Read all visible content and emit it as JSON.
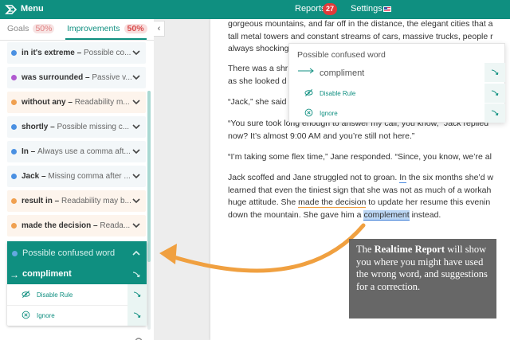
{
  "topbar": {
    "menu_label": "Menu",
    "reports_label": "Reports",
    "reports_count": "27",
    "settings_label": "Settings"
  },
  "sidebar": {
    "tabs": [
      {
        "label": "Goals",
        "pct": "50%"
      },
      {
        "label": "Improvements",
        "pct": "50%"
      }
    ],
    "items": [
      {
        "word": "in it's extreme",
        "desc": "Possible co...",
        "color": "#4a90e2"
      },
      {
        "word": "was surrounded",
        "desc": "Passive v...",
        "color": "#b05ad0"
      },
      {
        "word": "without any",
        "desc": "Readability m...",
        "color": "#f0a050"
      },
      {
        "word": "shortly",
        "desc": "Possible missing c...",
        "color": "#4a90e2"
      },
      {
        "word": "In",
        "desc": "Always use a comma aft...",
        "color": "#4a90e2"
      },
      {
        "word": "Jack",
        "desc": "Missing comma after ...",
        "color": "#4a90e2"
      },
      {
        "word": "result in",
        "desc": "Readability may b...",
        "color": "#f0a050"
      },
      {
        "word": "made the decision",
        "desc": "Reada...",
        "color": "#f0a050"
      }
    ],
    "card": {
      "title": "Possible confused word",
      "arrow": "→",
      "suggestion": "compliment",
      "disable_label": "Disable Rule",
      "ignore_label": "Ignore"
    }
  },
  "document": {
    "p1": [
      "gorgeous mountains, and far off in the distance, the elegant cities that a",
      "tall metal towers and constant streams of cars, massive trucks, people r",
      "always shocking"
    ],
    "p2": [
      "There was a shr",
      "as she looked d"
    ],
    "p3": [
      "“Jack,” she said"
    ],
    "p4": [
      "“You sure took long enough to answer my call, you know,” Jack replied",
      "now? It’s almost 9:00 AM and you’re still not here.”"
    ],
    "p5": [
      "“I’m taking some flex time,” Jane responded. “Since, you know, we’re al"
    ],
    "p6a": "Jack scoffed and Jane struggled not to groan. ",
    "p6a_in": "In",
    "p6a_rest": " the six months she’d w",
    "p6b": "learned that even the tiniest sign that she was not as much of a workah",
    "p6c_pre": "huge attitude. She ",
    "p6c_ul": "made the decision",
    "p6c_post": " to update her resume this evenin",
    "p6d_pre": "down the mountain. She gave him a ",
    "p6d_hl": "complement",
    "p6d_post": " instead."
  },
  "popup": {
    "title": "Possible confused word",
    "suggestion": "compliment",
    "disable_label": "Disable Rule",
    "ignore_label": "Ignore"
  },
  "note": {
    "pre": "The ",
    "bold": "Realtime Report",
    "post": " will show you where you might have used the wrong word, and suggestions for a correction."
  },
  "colors": {
    "brand": "#0f8f80",
    "annotation_arrow": "#f0a040",
    "badge": "#e03a3a"
  }
}
